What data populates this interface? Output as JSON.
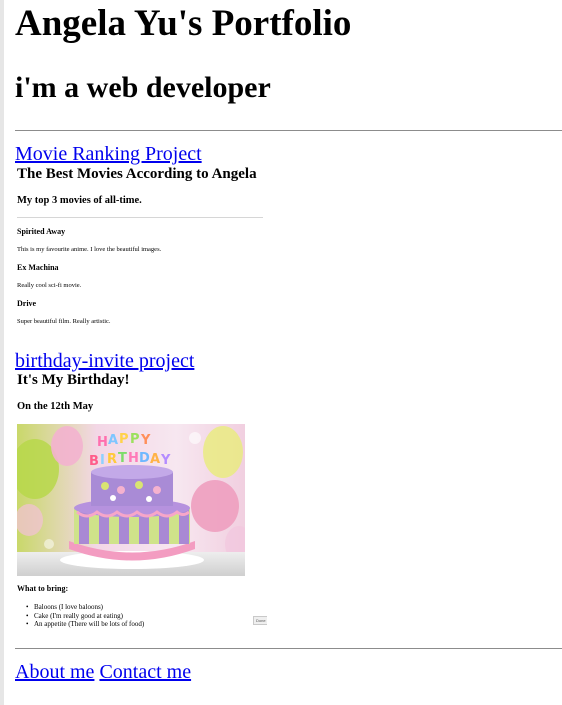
{
  "header": {
    "title": "Angela Yu's Portfolio",
    "subtitle": "i'm a web developer"
  },
  "projects": {
    "movie": {
      "link_text": "Movie Ranking Project",
      "heading": "The Best Movies According to Angela",
      "subheading": "My top 3 movies of all-time.",
      "movies": [
        {
          "title": "Spirited Away",
          "desc": "This is my favourite anime. I love the beautiful images."
        },
        {
          "title": "Ex Machina",
          "desc": "Really cool sci-fi movie."
        },
        {
          "title": "Drive",
          "desc": "Super beautiful film. Really artistic."
        }
      ]
    },
    "birthday": {
      "link_text": "birthday-invite project",
      "heading": "It's My Birthday!",
      "subheading": "On the 12th May",
      "bring_heading": "What to bring:",
      "items": [
        "Baloons (I love baloons)",
        "Cake (I'm really good at eating)",
        "An appetite (There will be lots of food)"
      ],
      "button_label": "Done"
    }
  },
  "footer": {
    "about": "About me",
    "contact": "Contact me"
  }
}
